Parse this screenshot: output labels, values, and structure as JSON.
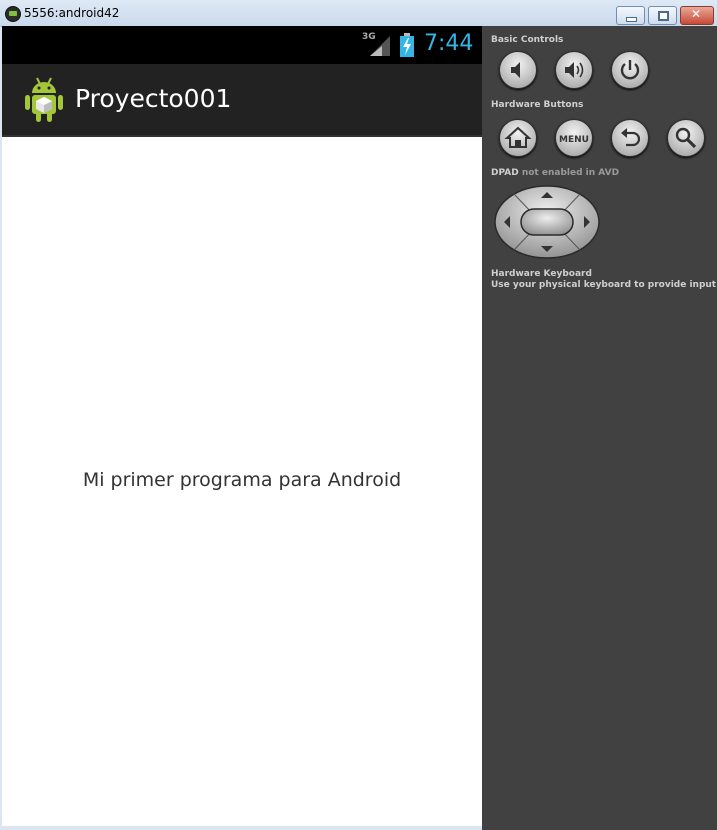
{
  "window": {
    "title": "5556:android42"
  },
  "device": {
    "network": "3G",
    "clock": "7:44",
    "app_name": "Proyecto001",
    "content_text": "Mi primer programa para Android"
  },
  "controls": {
    "basic_controls_label": "Basic Controls",
    "hardware_buttons_label": "Hardware Buttons",
    "menu_label": "MENU",
    "dpad_label": "DPAD",
    "dpad_note": "not enabled in AVD",
    "keyboard_label": "Hardware Keyboard",
    "keyboard_note": "Use your physical keyboard to provide input"
  },
  "colors": {
    "accent": "#33b5e5",
    "statusbar": "#000000",
    "actionbar": "#222222",
    "panel": "#414141"
  }
}
